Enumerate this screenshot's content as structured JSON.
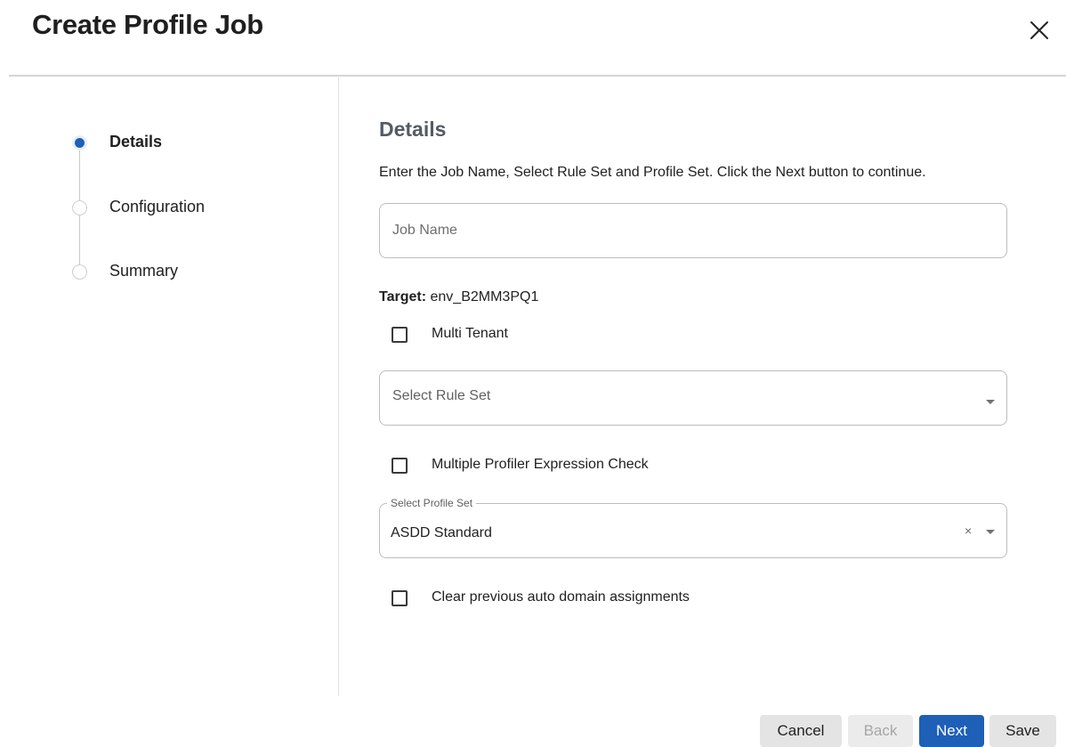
{
  "dialog": {
    "title": "Create Profile Job",
    "close_icon": "close-icon"
  },
  "stepper": {
    "steps": [
      {
        "label": "Details",
        "active": true
      },
      {
        "label": "Configuration",
        "active": false
      },
      {
        "label": "Summary",
        "active": false
      }
    ]
  },
  "details": {
    "title": "Details",
    "instructions": "Enter the Job Name, Select Rule Set and Profile Set. Click the Next button to continue.",
    "job_name": {
      "placeholder": "Job Name",
      "value": ""
    },
    "target": {
      "label": "Target:",
      "value": "env_B2MM3PQ1"
    },
    "multi_tenant": {
      "label": "Multi Tenant",
      "checked": false
    },
    "rule_set": {
      "placeholder": "Select Rule Set",
      "value": ""
    },
    "multiple_profiler": {
      "label": "Multiple Profiler Expression Check",
      "checked": false
    },
    "profile_set": {
      "label": "Select Profile Set",
      "value": "ASDD Standard",
      "clear_symbol": "×"
    },
    "clear_assignments": {
      "label": "Clear previous auto domain assignments",
      "checked": false
    }
  },
  "footer": {
    "cancel_label": "Cancel",
    "back_label": "Back",
    "next_label": "Next",
    "save_label": "Save"
  },
  "colors": {
    "accent": "#1e5fb7",
    "title_gray": "#555b63",
    "divider": "#d4d4d4"
  }
}
